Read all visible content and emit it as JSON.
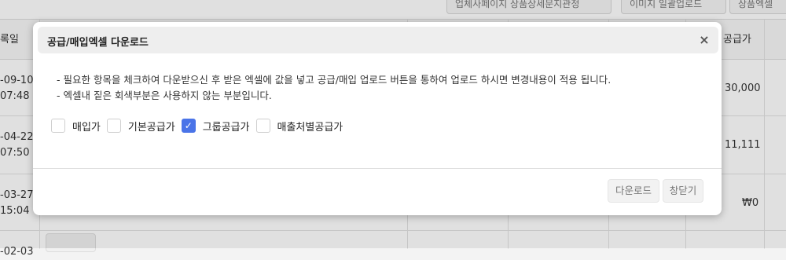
{
  "background": {
    "top_buttons": [
      "업체사페이지 상품상세문지관정",
      "이미지 일괄업로드",
      "상품엑셀"
    ],
    "columns": [
      "록일",
      "공급가"
    ],
    "rows": [
      {
        "date": "-09-10",
        "time": "07:48",
        "price": "30,000"
      },
      {
        "date": "-04-22",
        "time": "07:50",
        "price": "11,111"
      },
      {
        "date": "-03-27",
        "time": "15:04",
        "price": "₩0"
      },
      {
        "date": "-02-03",
        "time": "",
        "price": ""
      }
    ]
  },
  "modal": {
    "title": "공급/매입엑셀 다운로드",
    "close_icon": "×",
    "notes": [
      "- 필요한 항목을 체크하여 다운받으신 후 받은 엑셀에 값을 넣고 공급/매입 업로드 버튼을 통하여 업로드 하시면 변경내용이 적용 됩니다.",
      "- 엑셀내 짙은 회색부분은 사용하지 않는 부분입니다."
    ],
    "options": [
      {
        "label": "매입가",
        "checked": false
      },
      {
        "label": "기본공급가",
        "checked": false
      },
      {
        "label": "그룹공급가",
        "checked": true
      },
      {
        "label": "매출처별공급가",
        "checked": false
      }
    ],
    "buttons": {
      "download": "다운로드",
      "close": "창닫기"
    }
  },
  "colors": {
    "accent": "#4a74e8",
    "header_bg": "#eeeeee"
  }
}
